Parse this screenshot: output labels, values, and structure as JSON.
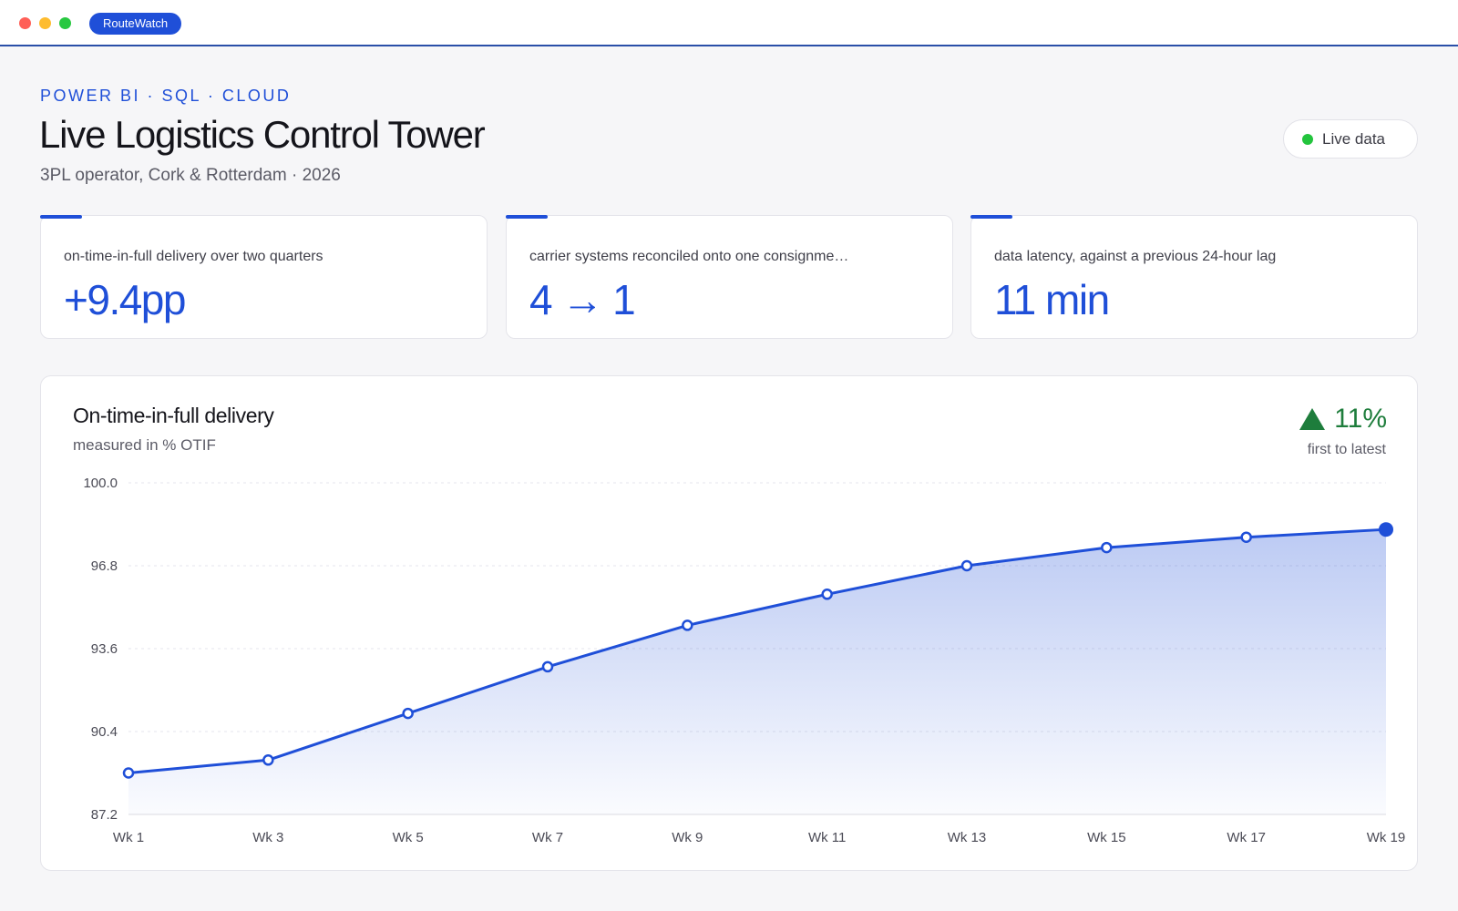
{
  "window": {
    "app_name": "RouteWatch"
  },
  "header": {
    "eyebrow": "POWER BI · SQL · CLOUD",
    "title": "Live Logistics Control Tower",
    "subtitle": "3PL operator, Cork & Rotterdam · 2026",
    "status_label": "Live data"
  },
  "kpis": [
    {
      "label": "on-time-in-full delivery over two quarters",
      "value": "+9.4pp"
    },
    {
      "label": "carrier systems reconciled onto one consignme…",
      "value": "4 → 1"
    },
    {
      "label": "data latency, against a previous 24-hour lag",
      "value": "11 min"
    }
  ],
  "chart_panel": {
    "title": "On-time-in-full delivery",
    "subtitle": "measured in % OTIF",
    "delta_value": "11%",
    "delta_caption": "first to latest"
  },
  "colors": {
    "accent": "#1f4fd8",
    "positive": "#1e7d3c",
    "live": "#23c43d"
  },
  "chart_data": {
    "type": "area",
    "x": [
      "Wk 1",
      "Wk 3",
      "Wk 5",
      "Wk 7",
      "Wk 9",
      "Wk 11",
      "Wk 13",
      "Wk 15",
      "Wk 17",
      "Wk 19"
    ],
    "series": [
      {
        "values": [
          88.8,
          89.3,
          91.1,
          92.9,
          94.5,
          95.7,
          96.8,
          97.5,
          97.9,
          98.2
        ]
      }
    ],
    "y_ticks": [
      "100.0",
      "96.8",
      "93.6",
      "90.4",
      "87.2"
    ],
    "ylim": [
      87.2,
      100.0
    ],
    "grid": true
  }
}
